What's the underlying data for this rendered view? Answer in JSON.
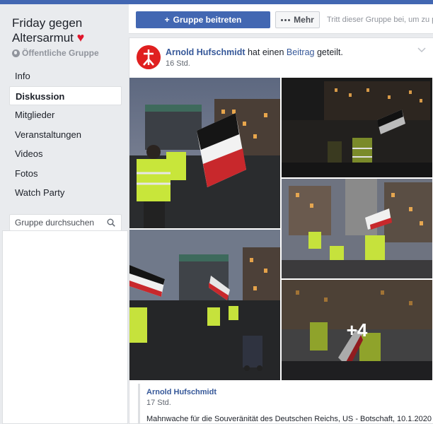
{
  "colors": {
    "brand": "#4267b2",
    "link": "#365899",
    "heart": "#e0162b"
  },
  "group": {
    "name": "Friday gegen Altersarmut",
    "heart_icon": "heart-icon",
    "privacy": "Öffentliche Gruppe"
  },
  "sidebar": {
    "items": [
      {
        "label": "Info"
      },
      {
        "label": "Diskussion",
        "active": true
      },
      {
        "label": "Mitglieder"
      },
      {
        "label": "Veranstaltungen"
      },
      {
        "label": "Videos"
      },
      {
        "label": "Fotos"
      },
      {
        "label": "Watch Party"
      }
    ],
    "search_placeholder": "Gruppe durchsuchen"
  },
  "actions": {
    "join_label": "Gruppe beitreten",
    "more_label": "Mehr",
    "hint": "Tritt dieser Gruppe bei, um zu p"
  },
  "post": {
    "author": "Arnold Hufschmidt",
    "verb": " hat einen ",
    "object": "Beitrag",
    "suffix": " geteilt.",
    "time": "16 Std.",
    "more_photos": "+4",
    "shared": {
      "author": "Arnold Hufschmidt",
      "time": "17 Std.",
      "text": "Mahnwache für die Souveränität des Deutschen Reichs, US - Botschaft, 10.1.2020"
    }
  }
}
